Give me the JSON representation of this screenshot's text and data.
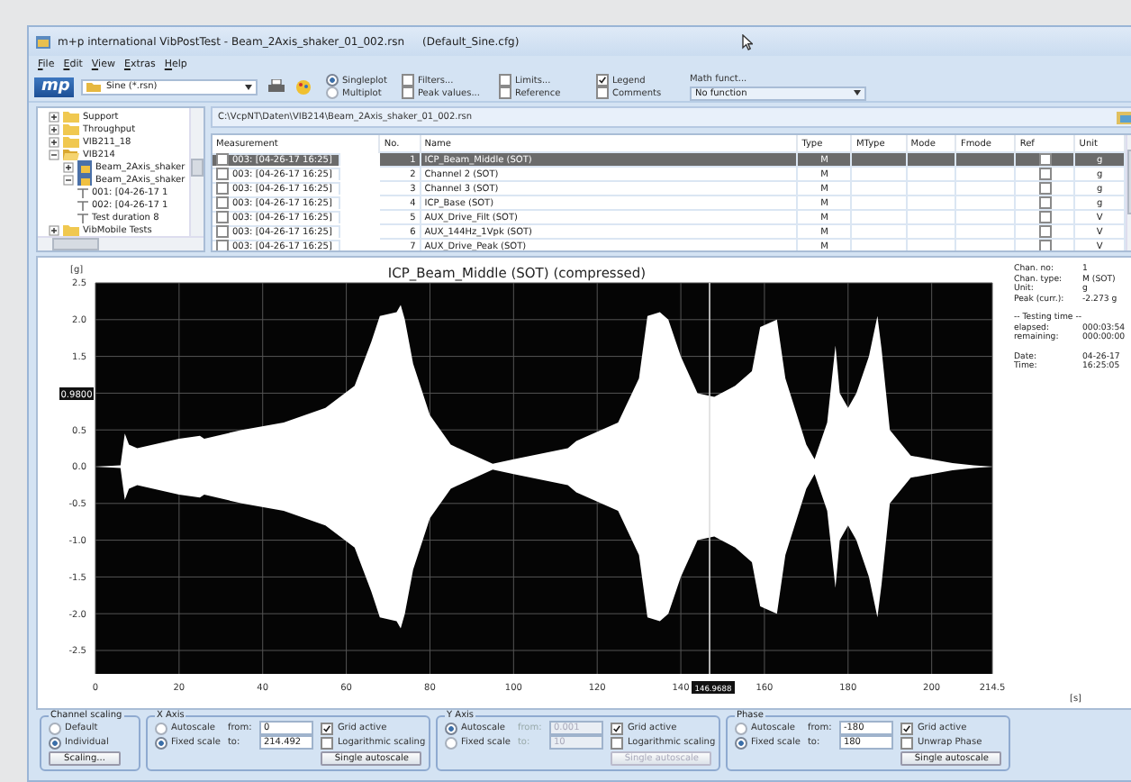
{
  "window": {
    "title": "m+p international VibPostTest - Beam_2Axis_shaker_01_002.rsn",
    "config": "(Default_Sine.cfg)"
  },
  "menu": [
    "File",
    "Edit",
    "View",
    "Extras",
    "Help"
  ],
  "toolbar": {
    "logo": "mp",
    "file_type": "Sine (*.rsn)",
    "plot_modes": [
      {
        "label": "Singleplot",
        "selected": true
      },
      {
        "label": "Multiplot",
        "selected": false
      }
    ],
    "options": [
      {
        "label": "Filters...",
        "checked": false
      },
      {
        "label": "Peak values...",
        "checked": false
      },
      {
        "label": "Limits...",
        "checked": false
      },
      {
        "label": "Reference",
        "checked": false
      },
      {
        "label": "Legend",
        "checked": true
      },
      {
        "label": "Comments",
        "checked": false
      }
    ],
    "math_label": "Math funct...",
    "math_function": "No function"
  },
  "tree": [
    {
      "label": "Support",
      "kind": "folder",
      "expanded": false
    },
    {
      "label": "Throughput",
      "kind": "folder",
      "expanded": false
    },
    {
      "label": "VIB211_18",
      "kind": "folder",
      "expanded": false
    },
    {
      "label": "VIB214",
      "kind": "folder",
      "expanded": true,
      "children": [
        {
          "label": "Beam_2Axis_shaker",
          "kind": "file",
          "expanded": false
        },
        {
          "label": "Beam_2Axis_shaker",
          "kind": "file",
          "expanded": true,
          "children": [
            {
              "label": "001: [04-26-17 1",
              "kind": "channel"
            },
            {
              "label": "002: [04-26-17 1",
              "kind": "channel"
            },
            {
              "label": "Test duration 8",
              "kind": "channel"
            }
          ]
        }
      ]
    },
    {
      "label": "VibMobile Tests",
      "kind": "folder",
      "expanded": false
    }
  ],
  "path": "C:\\VcpNT\\Daten\\VIB214\\Beam_2Axis_shaker_01_002.rsn",
  "table": {
    "columns": [
      "Measurement",
      "No.",
      "Name",
      "Type",
      "MType",
      "Mode",
      "Fmode",
      "Ref",
      "Unit"
    ],
    "rows": [
      {
        "measurement": "003: [04-26-17 16:25]",
        "no": "1",
        "name": "ICP_Beam_Middle (SOT)",
        "type": "M",
        "unit": "g",
        "checked": false,
        "ref": false,
        "selected": true
      },
      {
        "measurement": "003: [04-26-17 16:25]",
        "no": "2",
        "name": "Channel 2 (SOT)",
        "type": "M",
        "unit": "g",
        "checked": false,
        "ref": false,
        "selected": false
      },
      {
        "measurement": "003: [04-26-17 16:25]",
        "no": "3",
        "name": "Channel 3 (SOT)",
        "type": "M",
        "unit": "g",
        "checked": false,
        "ref": false,
        "selected": false
      },
      {
        "measurement": "003: [04-26-17 16:25]",
        "no": "4",
        "name": "ICP_Base (SOT)",
        "type": "M",
        "unit": "g",
        "checked": false,
        "ref": false,
        "selected": false
      },
      {
        "measurement": "003: [04-26-17 16:25]",
        "no": "5",
        "name": "AUX_Drive_Filt (SOT)",
        "type": "M",
        "unit": "V",
        "checked": false,
        "ref": false,
        "selected": false
      },
      {
        "measurement": "003: [04-26-17 16:25]",
        "no": "6",
        "name": "AUX_144Hz_1Vpk (SOT)",
        "type": "M",
        "unit": "V",
        "checked": false,
        "ref": false,
        "selected": false
      },
      {
        "measurement": "003: [04-26-17 16:25]",
        "no": "7",
        "name": "AUX_Drive_Peak (SOT)",
        "type": "M",
        "unit": "V",
        "checked": false,
        "ref": false,
        "selected": false
      }
    ]
  },
  "chart": {
    "title": "ICP_Beam_Middle (SOT) (compressed)",
    "y_unit": "[g]",
    "x_unit": "[s]",
    "y_ticks_upper": [
      "2.5",
      "2.0",
      "1.5"
    ],
    "y_ticks_lower": [
      "0.5",
      "0.0",
      "-0.5",
      "-1.0",
      "-1.5",
      "-2.0",
      "-2.5"
    ],
    "x_ticks": [
      "0",
      "20",
      "40",
      "60",
      "80",
      "100",
      "120",
      "140",
      "160",
      "180",
      "200",
      "214.5"
    ],
    "y_cursor": "0.9800",
    "x_cursor": "146.9688"
  },
  "info": [
    {
      "kind": "row",
      "label": "Chan. no:",
      "value": "1"
    },
    {
      "kind": "row",
      "label": "Chan. type:",
      "value": "M (SOT)"
    },
    {
      "kind": "row",
      "label": "Unit:",
      "value": "g"
    },
    {
      "kind": "row",
      "label": "Peak (curr.):",
      "value": "-2.273 g"
    },
    {
      "kind": "heading",
      "label": "-- Testing time --"
    },
    {
      "kind": "row",
      "label": "elapsed:",
      "value": "000:03:54"
    },
    {
      "kind": "row",
      "label": "remaining:",
      "value": "000:00:00"
    },
    {
      "kind": "gap_row",
      "label": "Date:",
      "value": "04-26-17"
    },
    {
      "kind": "row",
      "label": "Time:",
      "value": "16:25:05"
    }
  ],
  "channel_scaling": {
    "title": "Channel scaling",
    "options": [
      {
        "label": "Default",
        "selected": false
      },
      {
        "label": "Individual",
        "selected": true
      }
    ],
    "button": "Scaling..."
  },
  "axes": [
    {
      "title": "X Axis",
      "modes": [
        {
          "label": "Autoscale",
          "selected": false
        },
        {
          "label": "Fixed scale",
          "selected": true
        }
      ],
      "from_label": "from:",
      "from": "0",
      "to_label": "to:",
      "to": "214.492",
      "range_disabled": false,
      "checks": [
        {
          "label": "Grid active",
          "checked": true
        },
        {
          "label": "Logarithmic scaling",
          "checked": false
        }
      ],
      "button": "Single autoscale",
      "button_disabled": false
    },
    {
      "title": "Y Axis",
      "modes": [
        {
          "label": "Autoscale",
          "selected": true
        },
        {
          "label": "Fixed scale",
          "selected": false
        }
      ],
      "from_label": "from:",
      "from": "0.001",
      "to_label": "to:",
      "to": "10",
      "range_disabled": true,
      "checks": [
        {
          "label": "Grid active",
          "checked": true
        },
        {
          "label": "Logarithmic scaling",
          "checked": false
        }
      ],
      "button": "Single autoscale",
      "button_disabled": true
    },
    {
      "title": "Phase",
      "modes": [
        {
          "label": "Autoscale",
          "selected": false
        },
        {
          "label": "Fixed scale",
          "selected": true
        }
      ],
      "from_label": "from:",
      "from": "-180",
      "to_label": "to:",
      "to": "180",
      "range_disabled": false,
      "checks": [
        {
          "label": "Grid active",
          "checked": true
        },
        {
          "label": "Unwrap Phase",
          "checked": false
        }
      ],
      "button": "Single autoscale",
      "button_disabled": false
    }
  ]
}
